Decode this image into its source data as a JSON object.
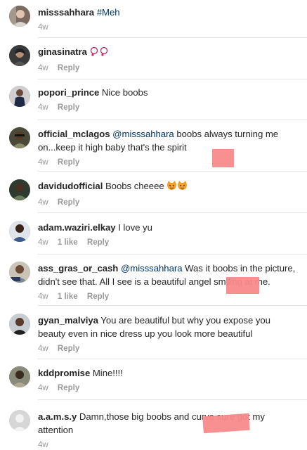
{
  "comments": [
    {
      "username": "misssahhara",
      "hashtag": "#Meh",
      "time": "4w",
      "show_reply": false
    },
    {
      "username": "ginasinatra",
      "emoji": "💭💭",
      "time": "4w",
      "reply": "Reply"
    },
    {
      "username": "popori_prince",
      "text": "Nice boobs",
      "time": "4w",
      "reply": "Reply"
    },
    {
      "username": "official_mclagos",
      "mention": "@misssahhara",
      "text": "boobs always turning me on...keep it high baby that's the spirit",
      "time": "4w",
      "reply": "Reply"
    },
    {
      "username": "davidudofficial",
      "text": "Boobs cheeee",
      "emoji": "😼😼",
      "time": "4w",
      "reply": "Reply"
    },
    {
      "username": "adam.waziri.elkay",
      "text": "I love yu",
      "time": "4w",
      "likes": "1 like",
      "reply": "Reply"
    },
    {
      "username": "ass_gras_or_cash",
      "mention": "@misssahhara",
      "text": "Was it boobs in the picture, didn't see that. All I see is a beautiful angel smiling at me.",
      "time": "4w",
      "likes": "1 like",
      "reply": "Reply"
    },
    {
      "username": "gyan_malviya",
      "text": "You are beautiful but why you expose you beauty even in nice dress up you look more beautiful",
      "time": "4w",
      "reply": "Reply"
    },
    {
      "username": "kddpromise",
      "text": "Mine!!!!",
      "time": "4w",
      "reply": "Reply"
    },
    {
      "username": "a.a.m.s.y",
      "text": "Damn,those big boobs and curve sure got my attention",
      "time": "4w"
    }
  ],
  "colors": {
    "username": "#262626",
    "mention": "#003569",
    "meta": "#999999",
    "divider": "#e6e6e6",
    "redaction": "#f88a8c"
  }
}
